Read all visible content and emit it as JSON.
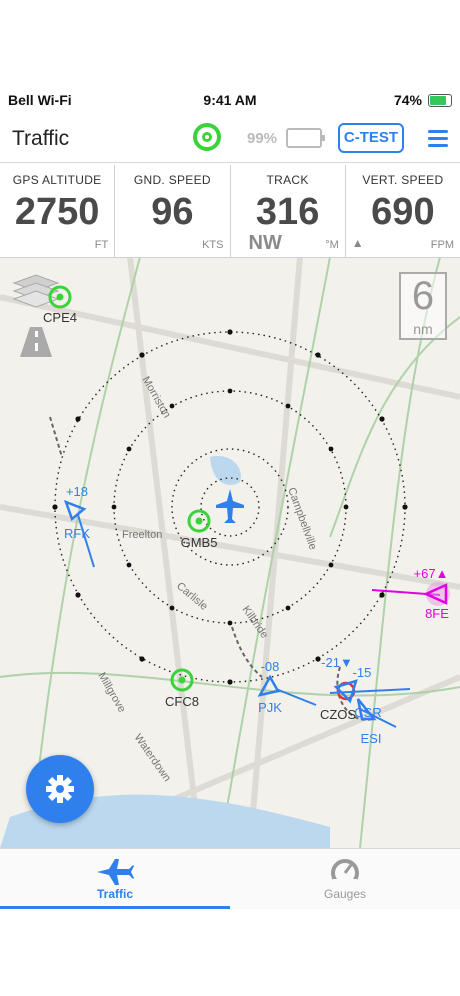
{
  "statusbar": {
    "carrier": "Bell Wi-Fi",
    "time": "9:41 AM",
    "battery": "74%"
  },
  "navbar": {
    "title": "Traffic",
    "device_battery": "99%",
    "device_button": "C-TEST"
  },
  "stats": [
    {
      "label": "GPS ALTITUDE",
      "value": "2750",
      "unit": "FT",
      "extra": ""
    },
    {
      "label": "GND. SPEED",
      "value": "96",
      "unit": "KTS",
      "extra": ""
    },
    {
      "label": "TRACK",
      "value": "316",
      "unit": "°M",
      "extra": ""
    },
    {
      "label": "VERT. SPEED",
      "value": "690",
      "unit": "FPM",
      "extra": "▲"
    }
  ],
  "map": {
    "compass_label": "NW",
    "range_value": "6",
    "range_unit": "nm",
    "airports": [
      {
        "id": "CPE4"
      },
      {
        "id": "GMB5"
      },
      {
        "id": "CFC8"
      }
    ],
    "traffic": [
      {
        "id": "RFK",
        "alt": "+18"
      },
      {
        "id": "PJK",
        "alt": "-08"
      },
      {
        "id": "8FE",
        "alt": "+67▲"
      },
      {
        "id": "ESI",
        "alt": "-21▼"
      },
      {
        "id": "CZOS",
        "alt": "-15"
      },
      {
        "id": "CSR",
        "alt": ""
      }
    ],
    "roads": [
      "Freelton",
      "Carlisle",
      "Kilbride",
      "Campbellville",
      "Millgrove",
      "Waterdown",
      "Morriston"
    ]
  },
  "tabs": [
    {
      "label": "Traffic",
      "active": true
    },
    {
      "label": "Gauges",
      "active": false
    }
  ],
  "colors": {
    "accent": "#2f80ed",
    "gps": "#3ad33a",
    "traffic_high": "#e000e0",
    "traffic": "#2f80ed"
  }
}
